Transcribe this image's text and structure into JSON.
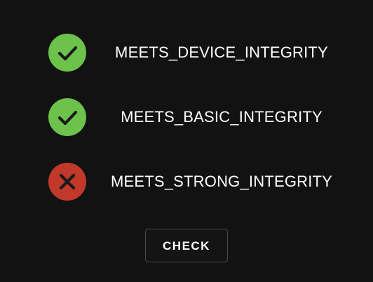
{
  "colors": {
    "background": "#121212",
    "pass": "#6cc24a",
    "fail": "#c0392b",
    "text": "#ffffff",
    "button_border": "#4a4a4a"
  },
  "checks": [
    {
      "label": "MEETS_DEVICE_INTEGRITY",
      "status": "pass",
      "icon": "check-icon"
    },
    {
      "label": "MEETS_BASIC_INTEGRITY",
      "status": "pass",
      "icon": "check-icon"
    },
    {
      "label": "MEETS_STRONG_INTEGRITY",
      "status": "fail",
      "icon": "cross-icon"
    }
  ],
  "button": {
    "label": "CHECK"
  }
}
